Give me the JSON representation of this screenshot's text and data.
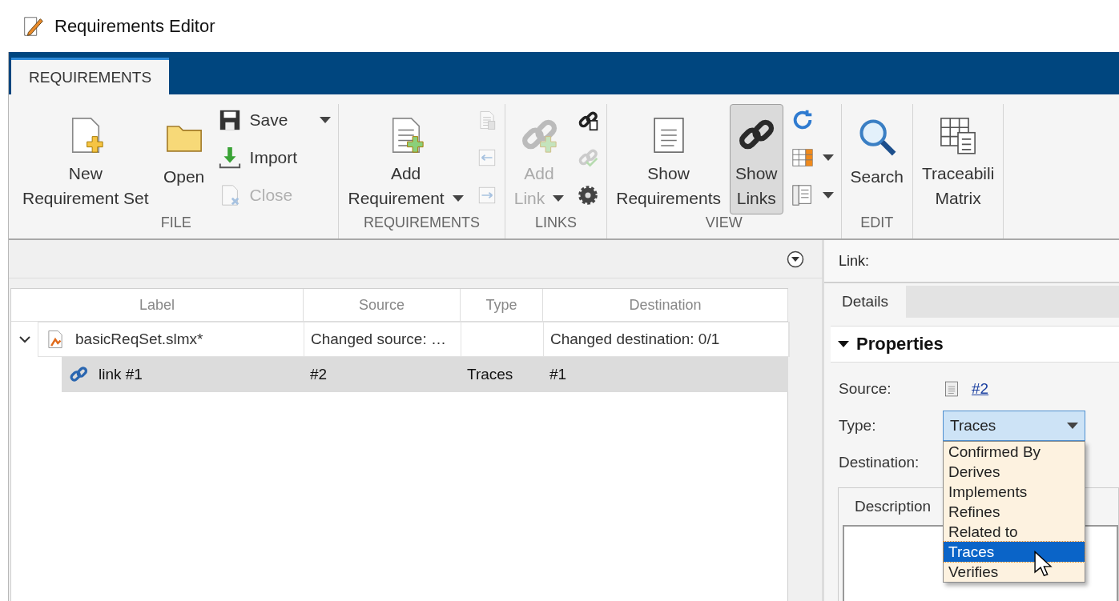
{
  "window": {
    "title": "Requirements Editor"
  },
  "ribbon_tabs": [
    {
      "label": "REQUIREMENTS",
      "selected": true
    }
  ],
  "ribbon_groups": [
    {
      "label": "FILE",
      "columns": [
        [
          {
            "kind": "large",
            "label": "New\nRequirement Set",
            "disabled": false,
            "menu": false,
            "pressed": false
          }
        ],
        [
          {
            "kind": "large",
            "label": "Open",
            "disabled": false,
            "menu": false,
            "pressed": false
          }
        ],
        [
          {
            "kind": "small",
            "label": "Save",
            "disabled": false,
            "menu": true,
            "pressed": false
          },
          {
            "kind": "small",
            "label": "Import",
            "disabled": false,
            "menu": false,
            "pressed": false
          },
          {
            "kind": "small",
            "label": "Close",
            "disabled": true,
            "menu": false,
            "pressed": false
          }
        ]
      ]
    },
    {
      "label": "REQUIREMENTS",
      "columns": [
        [
          {
            "kind": "large",
            "label": "Add\nRequirement",
            "disabled": false,
            "menu": true,
            "pressed": false
          }
        ],
        [
          {
            "kind": "icon",
            "disabled": true,
            "menu": false,
            "pressed": false
          },
          {
            "kind": "icon",
            "disabled": true,
            "menu": false,
            "pressed": false
          },
          {
            "kind": "icon",
            "disabled": true,
            "menu": false,
            "pressed": false
          }
        ]
      ]
    },
    {
      "label": "LINKS",
      "columns": [
        [
          {
            "kind": "large",
            "label": "Add\nLink",
            "disabled": true,
            "menu": true,
            "pressed": false
          }
        ],
        [
          {
            "kind": "icon",
            "disabled": false,
            "menu": false,
            "pressed": false
          },
          {
            "kind": "icon",
            "disabled": true,
            "menu": false,
            "pressed": false
          },
          {
            "kind": "icon",
            "disabled": false,
            "menu": false,
            "pressed": false
          }
        ]
      ]
    },
    {
      "label": "VIEW",
      "columns": [
        [
          {
            "kind": "large",
            "label": "Show\nRequirements",
            "disabled": false,
            "menu": false,
            "pressed": false
          }
        ],
        [
          {
            "kind": "large",
            "label": "Show\nLinks",
            "disabled": false,
            "menu": false,
            "pressed": true
          }
        ],
        [
          {
            "kind": "icon",
            "disabled": false,
            "menu": false,
            "pressed": false
          },
          {
            "kind": "icon",
            "disabled": false,
            "menu": true,
            "pressed": false
          },
          {
            "kind": "icon",
            "disabled": false,
            "menu": true,
            "pressed": false
          }
        ]
      ]
    },
    {
      "label": "EDIT",
      "columns": [
        [
          {
            "kind": "large",
            "label": "Search",
            "disabled": false,
            "menu": false,
            "pressed": false
          }
        ]
      ]
    },
    {
      "columns": [
        [
          {
            "kind": "large",
            "label": "Traceabili\nMatrix",
            "disabled": false,
            "menu": false,
            "pressed": false
          }
        ]
      ]
    }
  ],
  "table": {
    "columns": [
      "Label",
      "Source",
      "Type",
      "Destination"
    ],
    "rows": [
      {
        "label": "basicReqSet.slmx*",
        "source": "Changed source: …",
        "destination": "Changed destination: 0/1",
        "expanded": true,
        "selected": false,
        "children": [
          {
            "label": "link #1",
            "source": "#2",
            "type": "Traces",
            "destination": "#1",
            "selected": true
          }
        ]
      }
    ]
  },
  "inspector": {
    "title": "Link:",
    "tabs": [
      {
        "label": "Details",
        "selected": true
      }
    ],
    "section": {
      "title": "Properties",
      "expanded": true
    },
    "source": {
      "label": "Source:",
      "value": "#2"
    },
    "type": {
      "label": "Type:",
      "value": "Traces",
      "expanded": true,
      "options": [
        {
          "label": "Confirmed By",
          "selected": false
        },
        {
          "label": "Derives",
          "selected": false
        },
        {
          "label": "Implements",
          "selected": false
        },
        {
          "label": "Refines",
          "selected": false
        },
        {
          "label": "Related to",
          "selected": false
        },
        {
          "label": "Traces",
          "selected": true
        },
        {
          "label": "Verifies",
          "selected": false
        }
      ]
    },
    "destination": {
      "label": "Destination:"
    },
    "description_tabs": [
      {
        "label": "Description",
        "selected": true
      }
    ]
  }
}
